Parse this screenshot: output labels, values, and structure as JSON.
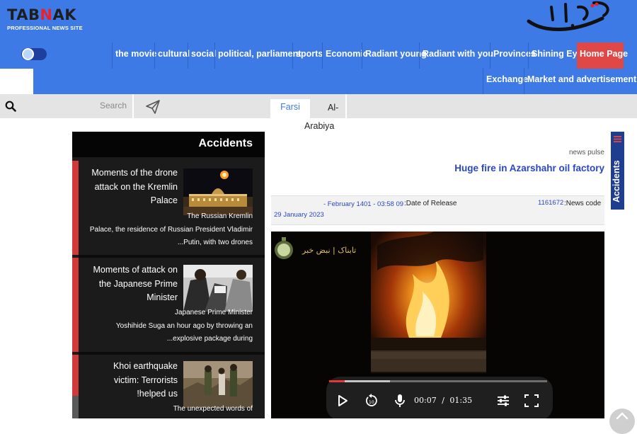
{
  "header": {
    "logo_en_part1": "TAB",
    "logo_en_part2": "N",
    "logo_en_part3": "AK",
    "logo_en_tagline": "PROFESSIONAL NEWS SITE",
    "logo_fa": "تابناک"
  },
  "nav": {
    "items_row1": [
      "the movie",
      "cultural",
      "social",
      "political, parliament",
      "sports",
      "Economic",
      "Radiant young",
      "Radiant with you",
      "Provinces",
      "Shining Eye",
      "Home Page"
    ],
    "items_row2": [
      "Exchange",
      "Market and advertisement"
    ]
  },
  "search": {
    "placeholder": "Search"
  },
  "tabs": {
    "farsi": "Farsi",
    "arabiya_line1": "Al-",
    "arabiya_line2": "Arabiya"
  },
  "sidebar": {
    "title": "Accidents",
    "items": [
      {
        "title_lines": [
          "Moments of the drone",
          "attack on the Kremlin",
          "Palace"
        ],
        "desc_lines": [
          "The Russian Kremlin",
          "Palace, the residence of Russian President Vladimir",
          "...Putin, with two drones"
        ]
      },
      {
        "title_lines": [
          "Moments of attack on",
          "the Japanese Prime",
          "Minister"
        ],
        "desc_lines": [
          "Japanese Prime Minister",
          "Yoshihide Suga an hour ago by throwing an",
          "...explosive package during"
        ]
      },
      {
        "title_lines": [
          "Khoi earthquake",
          "victim: Terrorists",
          "!helped us"
        ],
        "desc_lines": [
          "The unexpected words of"
        ]
      }
    ]
  },
  "article": {
    "kicker": "news pulse",
    "title": "Huge fire in Azarshahr oil factory",
    "date_value": "- February 1401 - 03:58 09",
    "date_label": ":Date of Release",
    "date_value2": "29 January 2023",
    "code_value": "1161672",
    "code_label": ":News code"
  },
  "video": {
    "watermark": "تابناک | نبض خبر",
    "time_current": "00:07",
    "time_separator": "/",
    "time_total": "01:35",
    "progress": 0.07,
    "buffered": 0.28
  },
  "vertical_tab": {
    "label": "Accidents"
  },
  "colors": {
    "brand_blue": "#3e7ae6",
    "home_red": "#e04848",
    "link_blue": "#2a46c8",
    "side_red": "#d23a3a"
  },
  "icons": [
    "search-icon",
    "send-icon",
    "menu-icon",
    "play-icon",
    "rewind-10-icon",
    "microphone-icon",
    "settings-sliders-icon",
    "fullscreen-icon",
    "chevron-up-icon",
    "theme-toggle"
  ]
}
